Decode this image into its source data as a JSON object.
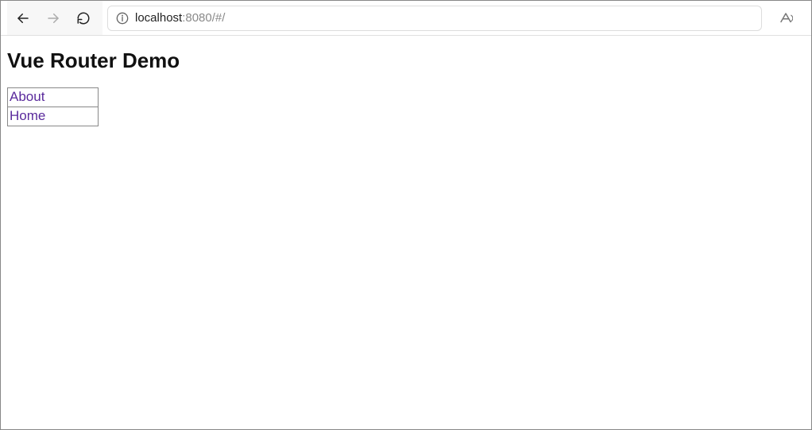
{
  "toolbar": {
    "address": {
      "host": "localhost",
      "port": ":8080",
      "path": "/#/"
    }
  },
  "page": {
    "heading": "Vue Router Demo",
    "links": {
      "about": "About",
      "home": "Home"
    }
  }
}
